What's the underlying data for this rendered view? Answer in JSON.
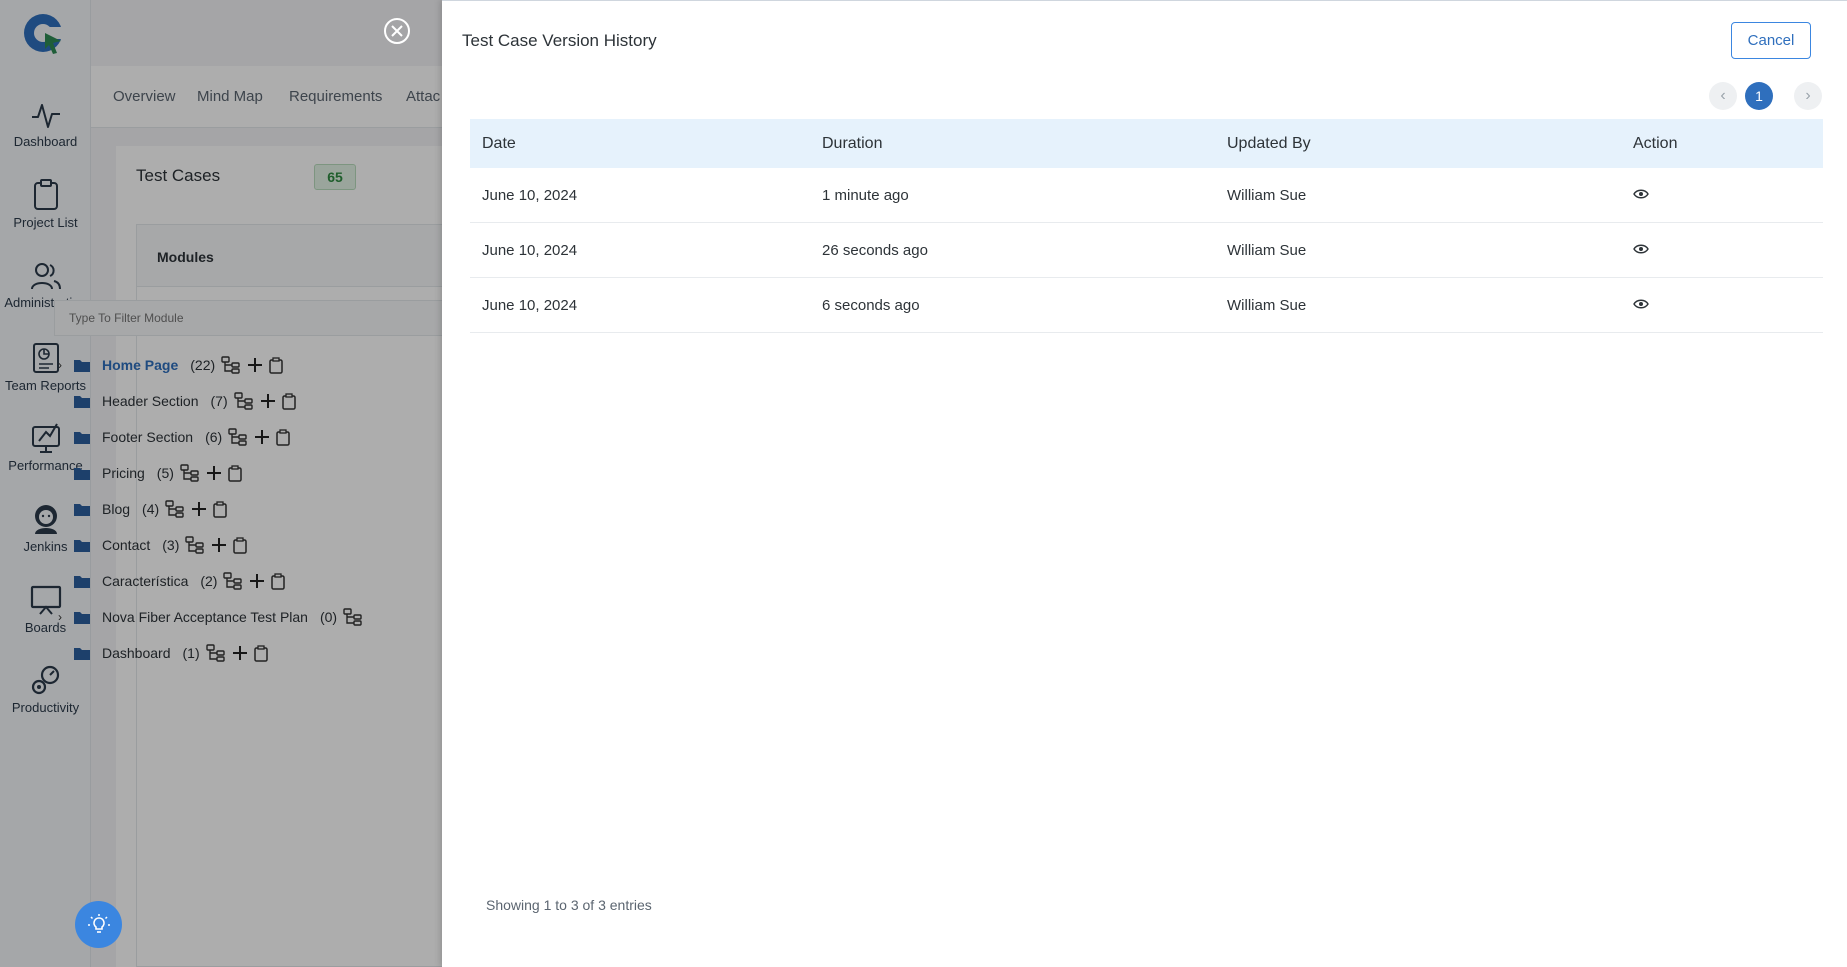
{
  "sidebar": {
    "items": [
      {
        "label": "Dashboard",
        "icon": "pulse-icon"
      },
      {
        "label": "Project List",
        "icon": "clipboard-icon"
      },
      {
        "label": "Administration",
        "icon": "users-icon"
      },
      {
        "label": "Team Reports",
        "icon": "report-icon"
      },
      {
        "label": "Performance",
        "icon": "performance-icon"
      },
      {
        "label": "Jenkins",
        "icon": "jenkins-icon"
      },
      {
        "label": "Boards",
        "icon": "board-icon"
      },
      {
        "label": "Productivity",
        "icon": "gears-icon"
      }
    ]
  },
  "tabs": [
    {
      "label": "Overview"
    },
    {
      "label": "Mind Map"
    },
    {
      "label": "Requirements"
    },
    {
      "label": "Attac"
    }
  ],
  "test_cases": {
    "title": "Test Cases",
    "count": "65"
  },
  "modules": {
    "title": "Modules",
    "filter_placeholder": "Type To Filter Module",
    "items": [
      {
        "name": "Home Page",
        "count": "(22)",
        "expandable": true,
        "active": true
      },
      {
        "name": "Header Section",
        "count": "(7)",
        "expandable": false,
        "active": false
      },
      {
        "name": "Footer Section",
        "count": "(6)",
        "expandable": false,
        "active": false
      },
      {
        "name": "Pricing",
        "count": "(5)",
        "expandable": false,
        "active": false
      },
      {
        "name": "Blog",
        "count": "(4)",
        "expandable": false,
        "active": false
      },
      {
        "name": "Contact",
        "count": "(3)",
        "expandable": false,
        "active": false
      },
      {
        "name": "Característica",
        "count": "(2)",
        "expandable": false,
        "active": false
      },
      {
        "name": "Nova Fiber Acceptance Test Plan",
        "count": "(0)",
        "expandable": true,
        "active": false
      },
      {
        "name": "Dashboard",
        "count": "(1)",
        "expandable": false,
        "active": false
      }
    ]
  },
  "modal": {
    "title": "Test Case Version History",
    "cancel_label": "Cancel",
    "pagination": {
      "prev": "‹",
      "current": "1",
      "next": "›"
    },
    "columns": [
      "Date",
      "Duration",
      "Updated By",
      "Action"
    ],
    "rows": [
      {
        "date": "June 10, 2024",
        "duration": "1 minute ago",
        "updated_by": "William Sue"
      },
      {
        "date": "June 10, 2024",
        "duration": "26 seconds ago",
        "updated_by": "William Sue"
      },
      {
        "date": "June 10, 2024",
        "duration": "6 seconds ago",
        "updated_by": "William Sue"
      }
    ],
    "entries_text": "Showing 1 to 3 of 3 entries"
  },
  "colors": {
    "accent": "#2f6fbd",
    "header_bg": "#e6f2fc",
    "fab": "#3b86e0"
  }
}
